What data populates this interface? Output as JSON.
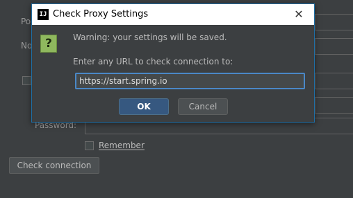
{
  "background": {
    "label_port": "Po",
    "label_no_proxy": "No",
    "label_password": "Password:",
    "remember_label": "Remember",
    "check_connection_label": "Check connection"
  },
  "dialog": {
    "title": "Check Proxy Settings",
    "app_icon_glyph": "IJ",
    "close_glyph": "✕",
    "warning_icon_glyph": "?",
    "warning_text": "Warning: your settings will be saved.",
    "prompt_text": "Enter any URL to check connection to:",
    "url_value": "https://start.spring.io",
    "ok_label": "OK",
    "cancel_label": "Cancel"
  },
  "colors": {
    "background": "#3c3f41",
    "accent": "#4a88c7",
    "primary_button": "#365880",
    "warning_icon": "#8fb85e"
  }
}
